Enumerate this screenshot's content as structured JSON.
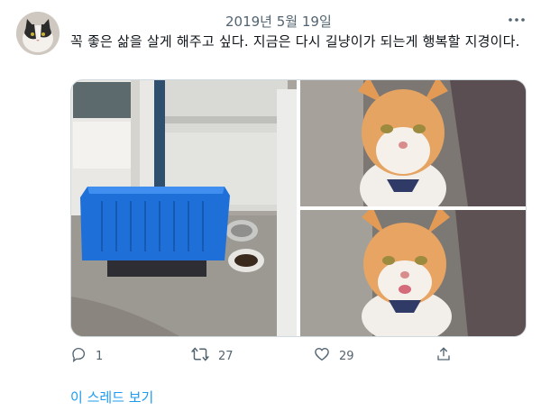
{
  "tweet": {
    "date": "2019년 5월 19일",
    "text": "꼭 좋은 삶을 살게 해주고 싶다. 지금은 다시 길냥이가 되는게 행복할 지경이다."
  },
  "actions": {
    "reply_count": "1",
    "retweet_count": "27",
    "like_count": "29"
  },
  "thread_link": "이 스레드 보기",
  "icons": [
    "more-icon",
    "reply-icon",
    "retweet-icon",
    "like-icon",
    "share-icon"
  ],
  "colors": {
    "text": "#0f1419",
    "secondary": "#536471",
    "link": "#1d9bf0"
  }
}
